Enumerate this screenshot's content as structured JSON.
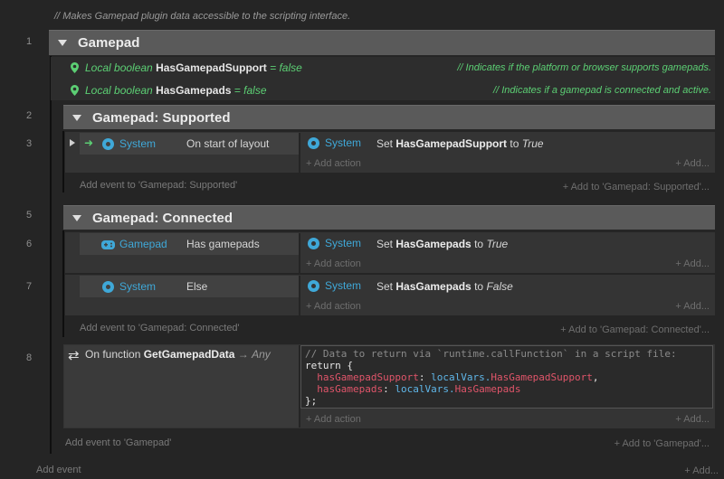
{
  "top_comment": "Makes Gamepad plugin data accessible to the scripting interface.",
  "line_numbers": [
    "1",
    "2",
    "3",
    "5",
    "6",
    "7",
    "8"
  ],
  "group_gamepad": {
    "title": "Gamepad",
    "add_event": "Add event to 'Gamepad'",
    "add_right": "Add to 'Gamepad'..."
  },
  "locals": [
    {
      "prefix": "Local boolean",
      "name": "HasGamepadSupport",
      "value": "= false",
      "comment": "Indicates if the platform or browser supports gamepads."
    },
    {
      "prefix": "Local boolean",
      "name": "HasGamepads",
      "value": "= false",
      "comment": "Indicates if a gamepad is connected and active."
    }
  ],
  "group_supported": {
    "title": "Gamepad: Supported",
    "add_event": "Add event to 'Gamepad: Supported'",
    "add_right": "Add to 'Gamepad: Supported'..."
  },
  "group_connected": {
    "title": "Gamepad: Connected",
    "add_event": "Add event to 'Gamepad: Connected'",
    "add_right": "Add to 'Gamepad: Connected'..."
  },
  "event3": {
    "cond_obj": "System",
    "cond_text": "On start of layout",
    "act_obj": "System",
    "act_prefix": "Set",
    "act_var": "HasGamepadSupport",
    "act_to": "to",
    "act_val": "True"
  },
  "event6": {
    "cond_obj": "Gamepad",
    "cond_text": "Has gamepads",
    "act_obj": "System",
    "act_prefix": "Set",
    "act_var": "HasGamepads",
    "act_to": "to",
    "act_val": "True"
  },
  "event7": {
    "cond_obj": "System",
    "cond_text": "Else",
    "act_obj": "System",
    "act_prefix": "Set",
    "act_var": "HasGamepads",
    "act_to": "to",
    "act_val": "False"
  },
  "event8": {
    "prefix": "On function",
    "name": "GetGamepadData",
    "ret": "Any",
    "code": {
      "l1": "// Data to return via `runtime.callFunction` in a script file:",
      "l2": "return {",
      "l3a": "hasGamepadSupport",
      "l3b": "localVars.",
      "l3c": "HasGamepadSupport",
      "l4a": "hasGamepads",
      "l4b": "localVars.",
      "l4c": "HasGamepads",
      "l5": "};"
    }
  },
  "add_action": "Add action",
  "add_dots": "Add...",
  "add_event": "Add event"
}
